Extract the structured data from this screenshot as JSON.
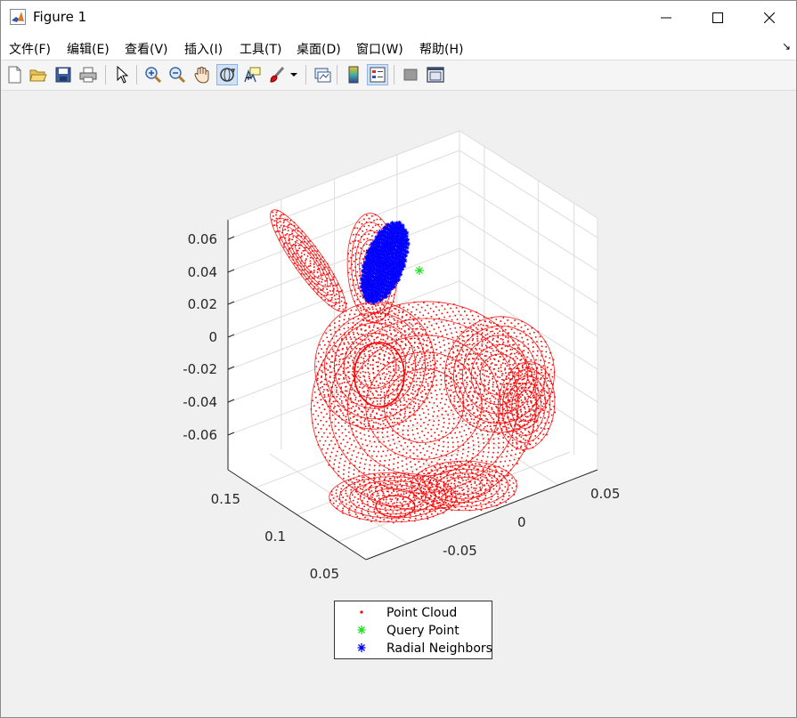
{
  "window": {
    "title": "Figure 1",
    "app_icon": "matlab-icon"
  },
  "window_controls": [
    "minimize-icon",
    "maximize-icon",
    "close-icon"
  ],
  "menu": [
    "文件(F)",
    "编辑(E)",
    "查看(V)",
    "插入(I)",
    "工具(T)",
    "桌面(D)",
    "窗口(W)",
    "帮助(H)"
  ],
  "toolbar": [
    "new-figure-icon",
    "open-file-icon",
    "save-icon",
    "print-icon",
    "edit-plot-arrow-icon",
    "zoom-in-icon",
    "zoom-out-icon",
    "pan-hand-icon",
    "rotate-3d-icon",
    "data-cursor-icon",
    "brush-icon",
    "brush-dropdown-icon",
    "link-plot-icon",
    "insert-colorbar-icon",
    "insert-legend-icon",
    "hide-plot-tools-icon",
    "show-plot-tools-icon"
  ],
  "chart_data": {
    "type": "scatter",
    "projection": "3d",
    "grid": true,
    "z_ticks": [
      "0.06",
      "0.04",
      "0.02",
      "0",
      "-0.02",
      "-0.04",
      "-0.06"
    ],
    "y_ticks": [
      "0.15",
      "0.1",
      "0.05"
    ],
    "x_ticks": [
      "0.05",
      "0",
      "-0.05"
    ],
    "series": [
      {
        "name": "Point Cloud",
        "marker": "dot",
        "color": "#ff0000"
      },
      {
        "name": "Query Point",
        "marker": "asterisk",
        "color": "#00dd00"
      },
      {
        "name": "Radial Neighbors",
        "marker": "asterisk",
        "color": "#0000ff"
      }
    ],
    "legend_position": "bottom"
  }
}
